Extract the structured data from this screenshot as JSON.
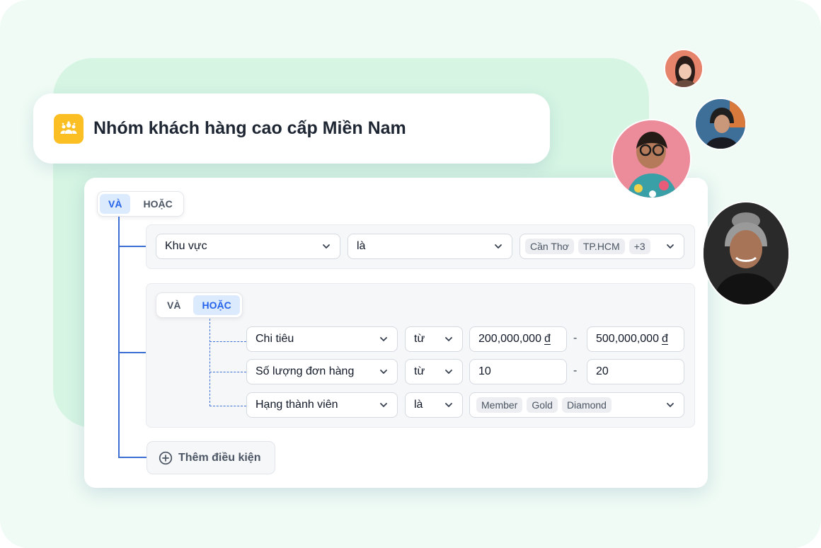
{
  "title": {
    "text": "Nhóm khách hàng cao cấp Miền Nam",
    "icon": "users-group-icon",
    "icon_color": "#fbbf24"
  },
  "root_toggle": {
    "and_label": "VÀ",
    "or_label": "HOẶC",
    "active": "and"
  },
  "region_condition": {
    "field": "Khu vực",
    "operator": "là",
    "values": [
      "Cần Thơ",
      "TP.HCM",
      "+3"
    ]
  },
  "nested_group": {
    "toggle": {
      "and_label": "VÀ",
      "or_label": "HOẶC",
      "active": "or"
    },
    "conditions": [
      {
        "field": "Chi tiêu",
        "operator": "từ",
        "from": "200,000,000",
        "to": "500,000,000",
        "currency": "đ"
      },
      {
        "field": "Số lượng đơn hàng",
        "operator": "từ",
        "from": "10",
        "to": "20"
      },
      {
        "field": "Hạng thành viên",
        "operator": "là",
        "values": [
          "Member",
          "Gold",
          "Diamond"
        ]
      }
    ],
    "range_separator": "-"
  },
  "add_condition": {
    "label": "Thêm điều kiện",
    "icon": "plus-circle-icon"
  },
  "colors": {
    "accent": "#2563eb",
    "connector": "#3b6fd4",
    "background": "#effbf4"
  }
}
